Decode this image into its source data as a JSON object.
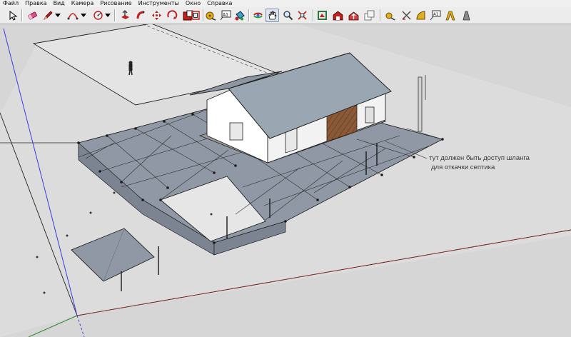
{
  "menu": {
    "items": [
      "Файл",
      "Правка",
      "Вид",
      "Камера",
      "Рисование",
      "Инструменты",
      "Окно",
      "Справка"
    ]
  },
  "toolbar": {
    "tools": [
      {
        "name": "select-tool-button",
        "icon": "arrow-pointer-icon"
      },
      {
        "name": "eraser-tool-button",
        "icon": "eraser-icon"
      },
      {
        "name": "pencil-tool-button",
        "icon": "pencil-icon"
      },
      {
        "name": "arc-tool-button",
        "icon": "arc-icon"
      },
      {
        "name": "circle-tool-button",
        "icon": "circle-icon"
      },
      {
        "name": "push-pull-tool-button",
        "icon": "push-pull-icon"
      },
      {
        "name": "follow-me-tool-button",
        "icon": "follow-me-icon"
      },
      {
        "name": "move-tool-button",
        "icon": "move-arrows-icon"
      },
      {
        "name": "rotate-tool-button",
        "icon": "rotate-icon"
      },
      {
        "name": "scale-tool-button",
        "icon": "scale-icon"
      },
      {
        "name": "offset-tool-button",
        "icon": "offset-icon"
      },
      {
        "name": "tape-measure-tool-button",
        "icon": "tape-measure-icon"
      },
      {
        "name": "text-tool-button",
        "icon": "text-label-icon"
      },
      {
        "name": "paint-bucket-tool-button",
        "icon": "paint-bucket-icon"
      },
      {
        "name": "orbit-tool-button",
        "icon": "orbit-icon"
      },
      {
        "name": "pan-tool-button",
        "icon": "hand-icon"
      },
      {
        "name": "zoom-tool-button",
        "icon": "magnifier-icon"
      },
      {
        "name": "zoom-extents-tool-button",
        "icon": "zoom-extents-icon"
      },
      {
        "name": "previous-view-button",
        "icon": "previous-view-icon"
      },
      {
        "name": "get-models-button",
        "icon": "warehouse-icon"
      },
      {
        "name": "share-model-button",
        "icon": "share-model-icon"
      },
      {
        "name": "components-button",
        "icon": "components-icon"
      },
      {
        "name": "dimension-tool-button",
        "icon": "dimension-icon"
      },
      {
        "name": "protractor-tool-button",
        "icon": "protractor-icon"
      },
      {
        "name": "axes-tool-button",
        "icon": "axes-icon"
      },
      {
        "name": "label-tool-button",
        "icon": "label-a1-icon"
      },
      {
        "name": "three-d-text-button",
        "icon": "three-d-text-icon"
      },
      {
        "name": "section-plane-button",
        "icon": "section-plane-icon"
      }
    ],
    "text_icon_label": "A1",
    "accent_color": "#d4a017"
  },
  "scene": {
    "annotation_lines": [
      "тут должен быть доступ шланга",
      "для откачки септика"
    ],
    "colors": {
      "background": "#d6d6d6",
      "ground": "#dedede",
      "paving": "#8f98a4",
      "paving_side": "#7b8490",
      "roof": "#9aa6b2",
      "wall": "#f2f2f2",
      "wood_panel": "#8a5a38",
      "axis_blue": "#3b3bdc",
      "axis_red": "#cc2222",
      "axis_green": "#2a8a2a"
    }
  }
}
